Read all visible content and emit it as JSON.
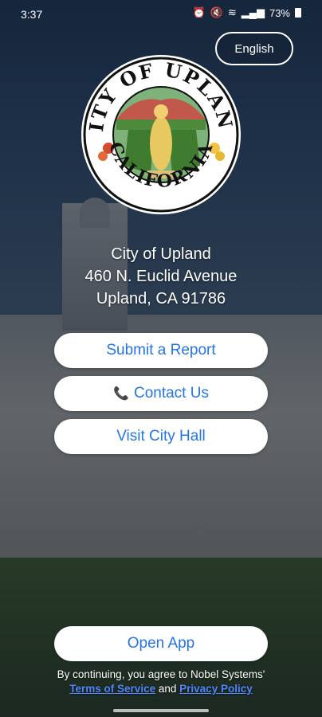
{
  "status_bar": {
    "time": "3:37",
    "battery": "73%",
    "icons": [
      "alarm-icon",
      "mute-icon",
      "wifi-icon",
      "signal-icon",
      "battery-icon"
    ]
  },
  "language_button": {
    "label": "English"
  },
  "seal": {
    "top_text": "CITY OF UPLAND",
    "bottom_text": "CALIFORNIA"
  },
  "address": {
    "line1": "City of Upland",
    "line2": "460 N. Euclid Avenue",
    "line3": "Upland, CA 91786"
  },
  "buttons": {
    "submit_report": "Submit a Report",
    "contact_us": "Contact Us",
    "visit_city_hall": "Visit City Hall",
    "open_app": "Open App"
  },
  "terms": {
    "prefix": "By continuing, you agree to Nobel Systems'",
    "terms_link": "Terms of Service",
    "and": "and",
    "privacy_link": "Privacy Policy"
  },
  "colors": {
    "button_text": "#2475e8",
    "link": "#4f86ff"
  }
}
